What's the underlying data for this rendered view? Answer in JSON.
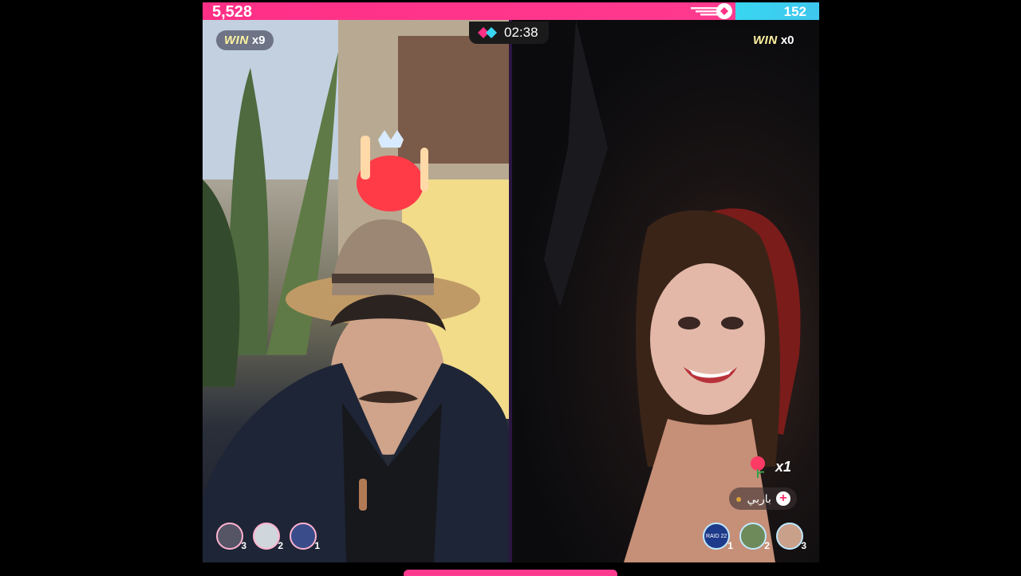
{
  "battle": {
    "left_score": "5,528",
    "right_score": "152",
    "timer": "02:38",
    "left_win": {
      "word": "WIN",
      "count": "x9"
    },
    "right_win": {
      "word": "WIN",
      "count": "x0"
    },
    "colors": {
      "left": "#ff2f86",
      "right": "#38d6f0"
    }
  },
  "right_panel": {
    "gift": {
      "icon": "rose-icon",
      "count": "x1"
    },
    "follow_chip": {
      "name": "باربي",
      "icon": "leopard-icon"
    }
  },
  "left_supporters": [
    {
      "rank": "3"
    },
    {
      "rank": "2"
    },
    {
      "rank": "1"
    }
  ],
  "right_supporters": [
    {
      "label": "RAID 22",
      "rank": "1"
    },
    {
      "rank": "2"
    },
    {
      "rank": "3"
    }
  ]
}
